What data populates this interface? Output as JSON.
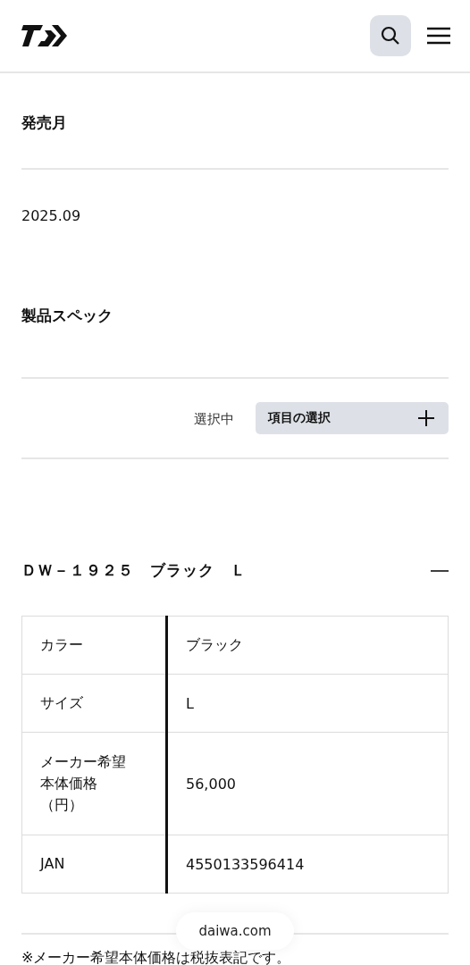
{
  "release": {
    "heading": "発売月",
    "value": "2025.09"
  },
  "spec": {
    "heading": "製品スペック",
    "selector_label": "選択中",
    "selector_button": "項目の選択"
  },
  "product": {
    "title": "ＤＷ－１９２５　ブラック　Ｌ",
    "expanded": true,
    "rows": [
      {
        "label": "カラー",
        "value": "ブラック"
      },
      {
        "label": "サイズ",
        "value": "L"
      },
      {
        "label_lines": [
          "メーカー希望",
          "本体価格",
          "（円）"
        ],
        "value": "56,000"
      },
      {
        "label": "JAN",
        "value": "4550133596414"
      }
    ]
  },
  "footnote": "※メーカー希望本体価格は税抜表記です。",
  "browser_url": "daiwa.com"
}
